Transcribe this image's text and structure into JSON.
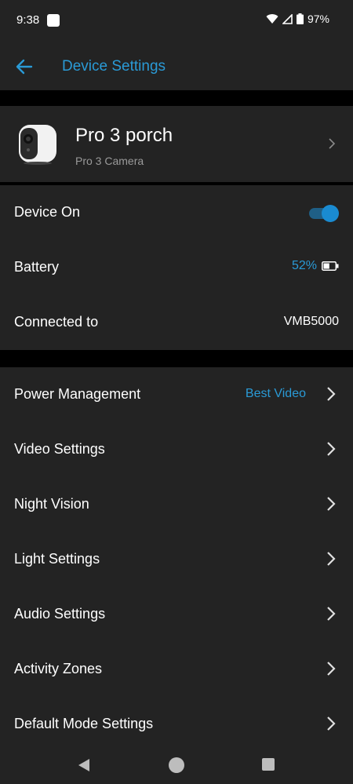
{
  "status_bar": {
    "time": "9:38",
    "battery_percent": "97%",
    "icons": [
      "notification-icon",
      "wifi-icon",
      "cell-signal-icon",
      "battery-icon"
    ]
  },
  "app_bar": {
    "title": "Device Settings",
    "back_icon": "arrow-left-icon"
  },
  "device": {
    "name": "Pro 3 porch",
    "model": "Pro 3 Camera",
    "chevron_icon": "chevron-right-icon"
  },
  "info": {
    "device_on_label": "Device On",
    "device_on_state": true,
    "battery_label": "Battery",
    "battery_value": "52%",
    "battery_level": 0.52,
    "connected_label": "Connected to",
    "connected_value": "VMB5000"
  },
  "settings": [
    {
      "label": "Power Management",
      "value": "Best Video"
    },
    {
      "label": "Video Settings",
      "value": ""
    },
    {
      "label": "Night Vision",
      "value": ""
    },
    {
      "label": "Light Settings",
      "value": ""
    },
    {
      "label": "Audio Settings",
      "value": ""
    },
    {
      "label": "Activity Zones",
      "value": ""
    },
    {
      "label": "Default Mode Settings",
      "value": ""
    }
  ],
  "colors": {
    "accent": "#2a9ad6",
    "surface": "#232323",
    "background": "#000000"
  }
}
